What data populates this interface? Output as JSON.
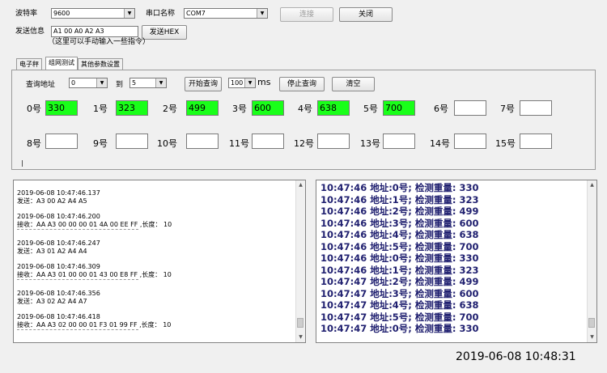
{
  "top": {
    "baud_label": "波特率",
    "baud_value": "9600",
    "port_label": "串口名称",
    "port_value": "COM7",
    "connect_label": "连接",
    "close_label": "关闭",
    "send_label": "发送信息",
    "send_value": "A1 00 A0 A2 A3",
    "send_hex_label": "发送HEX",
    "hint": "（这里可以手动输入一些指令）"
  },
  "tabs": [
    {
      "label": "电子秤",
      "active": false
    },
    {
      "label": "组网测试",
      "active": true
    },
    {
      "label": "其他参数设置",
      "active": false
    }
  ],
  "query": {
    "addr_label": "查询地址",
    "from_value": "0",
    "to_label": "到",
    "to_value": "5",
    "start_label": "开始查询",
    "interval_value": "100",
    "unit_label": "ms",
    "stop_label": "停止查询",
    "clear_label": "清空"
  },
  "slots": [
    {
      "label": "0号",
      "value": "330",
      "filled": true
    },
    {
      "label": "1号",
      "value": "323",
      "filled": true
    },
    {
      "label": "2号",
      "value": "499",
      "filled": true
    },
    {
      "label": "3号",
      "value": "600",
      "filled": true
    },
    {
      "label": "4号",
      "value": "638",
      "filled": true
    },
    {
      "label": "5号",
      "value": "700",
      "filled": true
    },
    {
      "label": "6号",
      "value": "",
      "filled": false
    },
    {
      "label": "7号",
      "value": "",
      "filled": false
    },
    {
      "label": "8号",
      "value": "",
      "filled": false
    },
    {
      "label": "9号",
      "value": "",
      "filled": false
    },
    {
      "label": "10号",
      "value": "",
      "filled": false
    },
    {
      "label": "11号",
      "value": "",
      "filled": false
    },
    {
      "label": "12号",
      "value": "",
      "filled": false
    },
    {
      "label": "13号",
      "value": "",
      "filled": false
    },
    {
      "label": "14号",
      "value": "",
      "filled": false
    },
    {
      "label": "15号",
      "value": "",
      "filled": false
    }
  ],
  "left_log": [
    {
      "time": "2019-06-08 10:47:46.137",
      "text": "发送：A3 00 A2 A4 A5",
      "sep": false
    },
    {
      "time": "2019-06-08 10:47:46.200",
      "text": "接收：AA A3 00 00 00 01 4A 00 EE FF ,长度： 10",
      "sep": true
    },
    {
      "time": "2019-06-08 10:47:46.247",
      "text": "发送：A3 01 A2 A4 A4",
      "sep": false
    },
    {
      "time": "2019-06-08 10:47:46.309",
      "text": "接收：AA A3 01 00 00 01 43 00 E8 FF ,长度： 10",
      "sep": true
    },
    {
      "time": "2019-06-08 10:47:46.356",
      "text": "发送：A3 02 A2 A4 A7",
      "sep": false
    },
    {
      "time": "2019-06-08 10:47:46.418",
      "text": "接收：AA A3 02 00 00 01 F3 01 99 FF ,长度： 10",
      "sep": true
    }
  ],
  "right_log": [
    "10:47:46  地址:0号; 检测重量: 330",
    "10:47:46  地址:1号; 检测重量: 323",
    "10:47:46  地址:2号; 检测重量: 499",
    "10:47:46  地址:3号; 检测重量: 600",
    "10:47:46  地址:4号; 检测重量: 638",
    "10:47:46  地址:5号; 检测重量: 700",
    "10:47:46  地址:0号; 检测重量: 330",
    "10:47:46  地址:1号; 检测重量: 323",
    "10:47:47  地址:2号; 检测重量: 499",
    "10:47:47  地址:3号; 检测重量: 600",
    "10:47:47  地址:4号; 检测重量: 638",
    "10:47:47  地址:5号; 检测重量: 700",
    "10:47:47  地址:0号; 检测重量: 330"
  ],
  "status": {
    "datetime": "2019-06-08  10:48:31"
  },
  "colors": {
    "filled_slot": "#19ff19",
    "log_text": "#202070"
  }
}
